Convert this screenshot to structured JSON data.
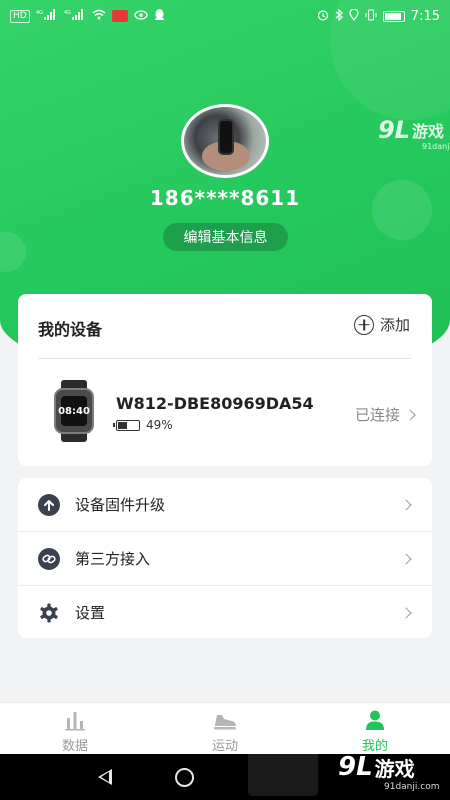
{
  "status_bar": {
    "left_chips": [
      "HD",
      "4G",
      "4G"
    ],
    "time": "7:15"
  },
  "profile": {
    "phone": "186****8611",
    "edit_label": "编辑基本信息"
  },
  "devices": {
    "title": "我的设备",
    "add_label": "添加",
    "device": {
      "watch_time": "08:40",
      "name": "W812-DBE80969DA54",
      "battery": "49%",
      "battery_level": 0.49,
      "status": "已连接"
    }
  },
  "menu": {
    "items": [
      {
        "label": "设备固件升级",
        "icon": "upload-icon"
      },
      {
        "label": "第三方接入",
        "icon": "link-icon"
      },
      {
        "label": "设置",
        "icon": "gear-icon"
      }
    ]
  },
  "bottom_nav": {
    "items": [
      {
        "label": "数据",
        "icon": "bar-chart-icon"
      },
      {
        "label": "运动",
        "icon": "shoe-icon"
      },
      {
        "label": "我的",
        "icon": "person-icon"
      }
    ],
    "active_index": 2
  },
  "watermark": {
    "brand_num": "9L",
    "brand_txt": "游戏",
    "site": "91danji.com"
  },
  "colors": {
    "primary_green": "#25c85c",
    "active_tab": "#22c35a",
    "icon_dark": "#3c4150"
  }
}
